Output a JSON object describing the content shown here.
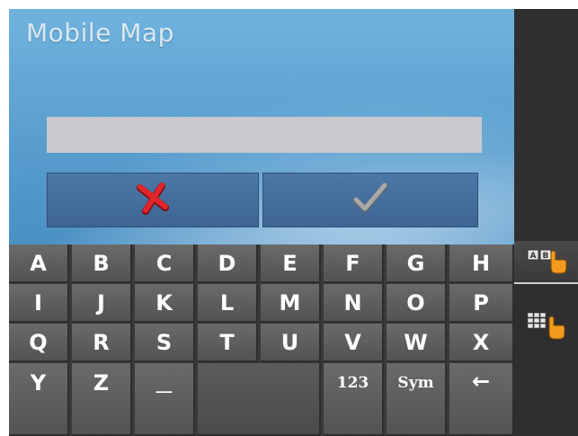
{
  "app": {
    "title": "Mobile Map"
  },
  "input": {
    "value": "",
    "placeholder": ""
  },
  "actions": {
    "cancel_icon": "x-icon",
    "confirm_icon": "check-icon"
  },
  "keyboard": {
    "rows": [
      [
        "A",
        "B",
        "C",
        "D",
        "E",
        "F",
        "G",
        "H"
      ],
      [
        "I",
        "J",
        "K",
        "L",
        "M",
        "N",
        "O",
        "P"
      ],
      [
        "Q",
        "R",
        "S",
        "T",
        "U",
        "V",
        "W",
        "X"
      ],
      [
        "Y",
        "Z",
        "__",
        "",
        "",
        "123",
        "Sym",
        "←"
      ]
    ]
  },
  "side": {
    "buttons": [
      {
        "icon": "abc-keyboard-icon",
        "active": true
      },
      {
        "icon": "numeric-keypad-icon",
        "active": false
      }
    ]
  },
  "colors": {
    "cancel": "#e0262b",
    "confirm": "#9a9a9a",
    "key": "#5f5f5f"
  }
}
